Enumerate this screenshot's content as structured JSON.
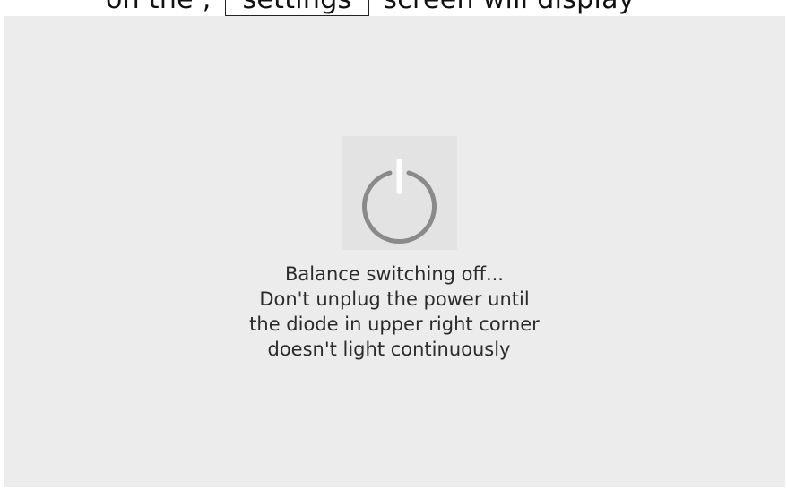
{
  "document_fragment": {
    "before": "on the , ",
    "boxed": "settings",
    "after": " screen will display"
  },
  "screen": {
    "icon": "power-icon",
    "message": {
      "line1": "Balance switching off...",
      "line2": "Don't unplug the power until",
      "line3": "the diode in upper right corner",
      "line4": "doesn't light continuously"
    },
    "colors": {
      "background": "#ececec",
      "icon_box": "#e3e3e3",
      "icon_stroke": "#8a8a8a",
      "icon_bar": "#ffffff",
      "text": "#2b2b2b"
    }
  }
}
